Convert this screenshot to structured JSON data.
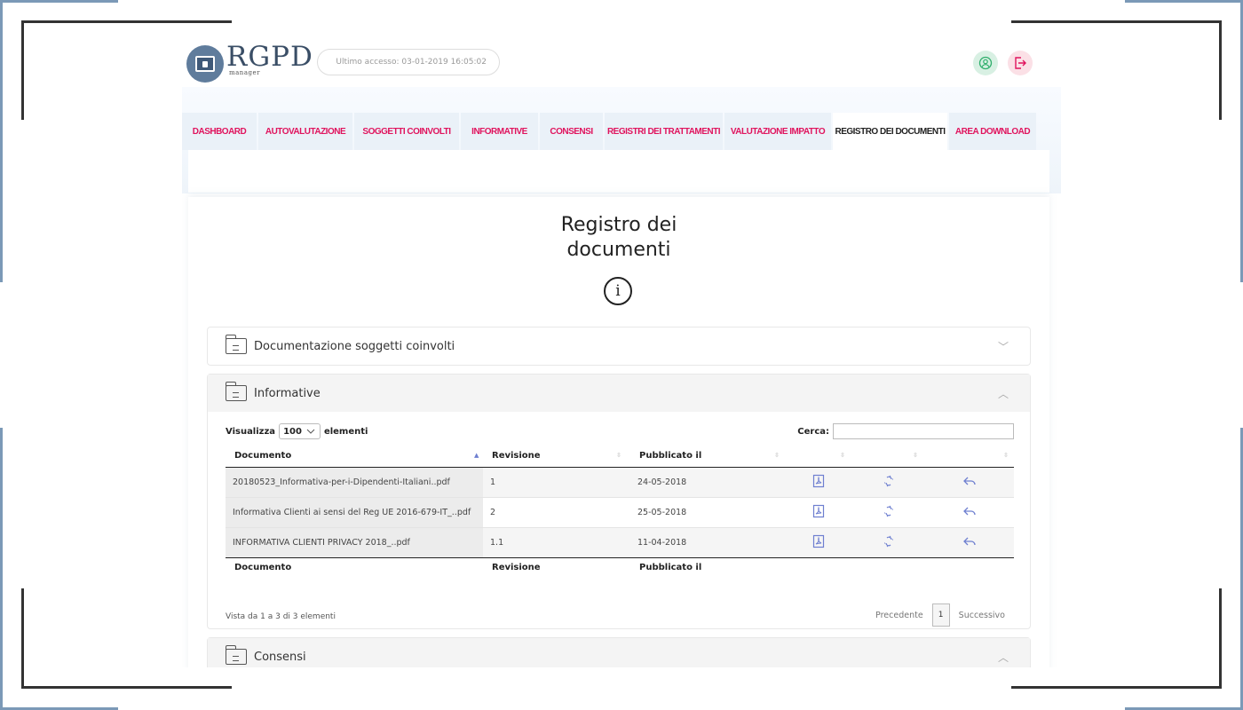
{
  "logo": {
    "title": "RGPD",
    "subtitle": "manager"
  },
  "header": {
    "last_access": "Ultimo accesso: 03-01-2019 16:05:02"
  },
  "colors": {
    "accent": "#e0135d",
    "icon": "#6e7fd0",
    "frame": "#7b99b7"
  },
  "tabs": [
    {
      "label": "DASHBOARD",
      "active": false
    },
    {
      "label": "AUTOVALUTAZIONE",
      "active": false
    },
    {
      "label": "SOGGETTI COINVOLTI",
      "active": false
    },
    {
      "label": "INFORMATIVE",
      "active": false
    },
    {
      "label": "CONSENSI",
      "active": false
    },
    {
      "label": "REGISTRI DEI TRATTAMENTI",
      "active": false
    },
    {
      "label": "VALUTAZIONE IMPATTO",
      "active": false
    },
    {
      "label": "REGISTRO DEI DOCUMENTI",
      "active": true
    },
    {
      "label": "AREA DOWNLOAD",
      "active": false
    }
  ],
  "page": {
    "title_line1": "Registro dei",
    "title_line2": "documenti",
    "info_glyph": "i"
  },
  "accordions": [
    {
      "title": "Documentazione soggetti coinvolti",
      "expanded": false
    },
    {
      "title": "Informative",
      "expanded": true
    },
    {
      "title": "Consensi",
      "expanded": true
    }
  ],
  "table": {
    "length_prefix": "Visualizza",
    "length_value": "100",
    "length_suffix": "elementi",
    "search_label": "Cerca:",
    "search_value": "",
    "columns": [
      "Documento",
      "Revisione",
      "Pubblicato il"
    ],
    "rows": [
      {
        "doc": "20180523_Informativa-per-i-Dipendenti-Italiani..pdf",
        "rev": "1",
        "date": "24-05-2018"
      },
      {
        "doc": "Informativa Clienti ai sensi del Reg UE 2016-679-IT_..pdf",
        "rev": "2",
        "date": "25-05-2018"
      },
      {
        "doc": "INFORMATIVA CLIENTI PRIVACY 2018_..pdf",
        "rev": "1.1",
        "date": "11-04-2018"
      }
    ],
    "info": "Vista da 1 a 3 di 3 elementi",
    "pager": {
      "prev": "Precedente",
      "current": "1",
      "next": "Successivo"
    }
  }
}
